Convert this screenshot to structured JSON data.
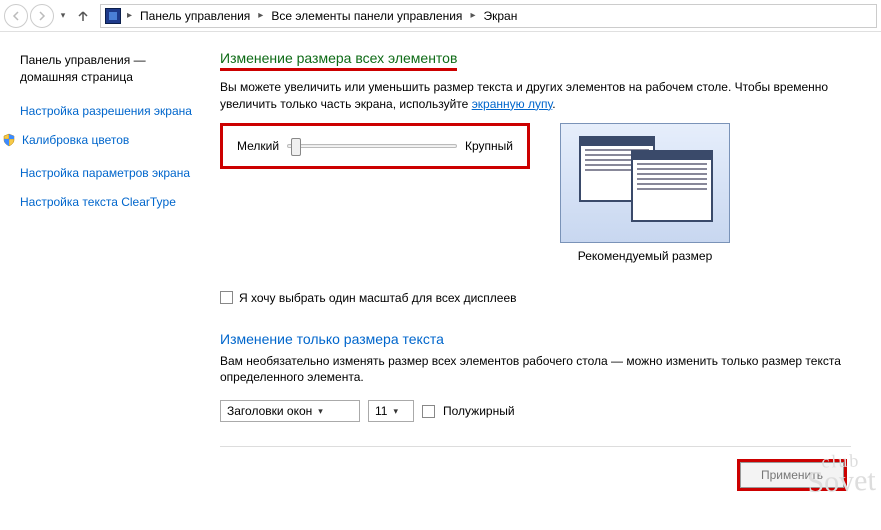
{
  "breadcrumb": {
    "root": "Панель управления",
    "mid": "Все элементы панели управления",
    "leaf": "Экран"
  },
  "sidebar": {
    "home_line1": "Панель управления —",
    "home_line2": "домашняя страница",
    "links": [
      {
        "label": "Настройка разрешения экрана",
        "shield": false
      },
      {
        "label": "Калибровка цветов",
        "shield": true
      },
      {
        "label": "Настройка параметров экрана",
        "shield": false
      },
      {
        "label": "Настройка текста ClearType",
        "shield": false
      }
    ]
  },
  "main": {
    "heading": "Изменение размера всех элементов",
    "desc_prefix": "Вы можете увеличить или уменьшить размер текста и других элементов на рабочем столе. Чтобы временно увеличить только часть экрана, используйте ",
    "desc_link": "экранную лупу",
    "desc_suffix": ".",
    "slider_min": "Мелкий",
    "slider_max": "Крупный",
    "recommended": "Рекомендуемый размер",
    "checkbox_label": "Я хочу выбрать один масштаб для всех дисплеев",
    "subheading": "Изменение только размера текста",
    "sub_desc": "Вам необязательно изменять размер всех элементов рабочего стола — можно изменить только размер текста определенного элемента.",
    "select_element": "Заголовки окон",
    "select_size": "11",
    "bold_label": "Полужирный",
    "apply": "Применить"
  },
  "watermark": {
    "top": "club",
    "bottom": "Sovet"
  }
}
